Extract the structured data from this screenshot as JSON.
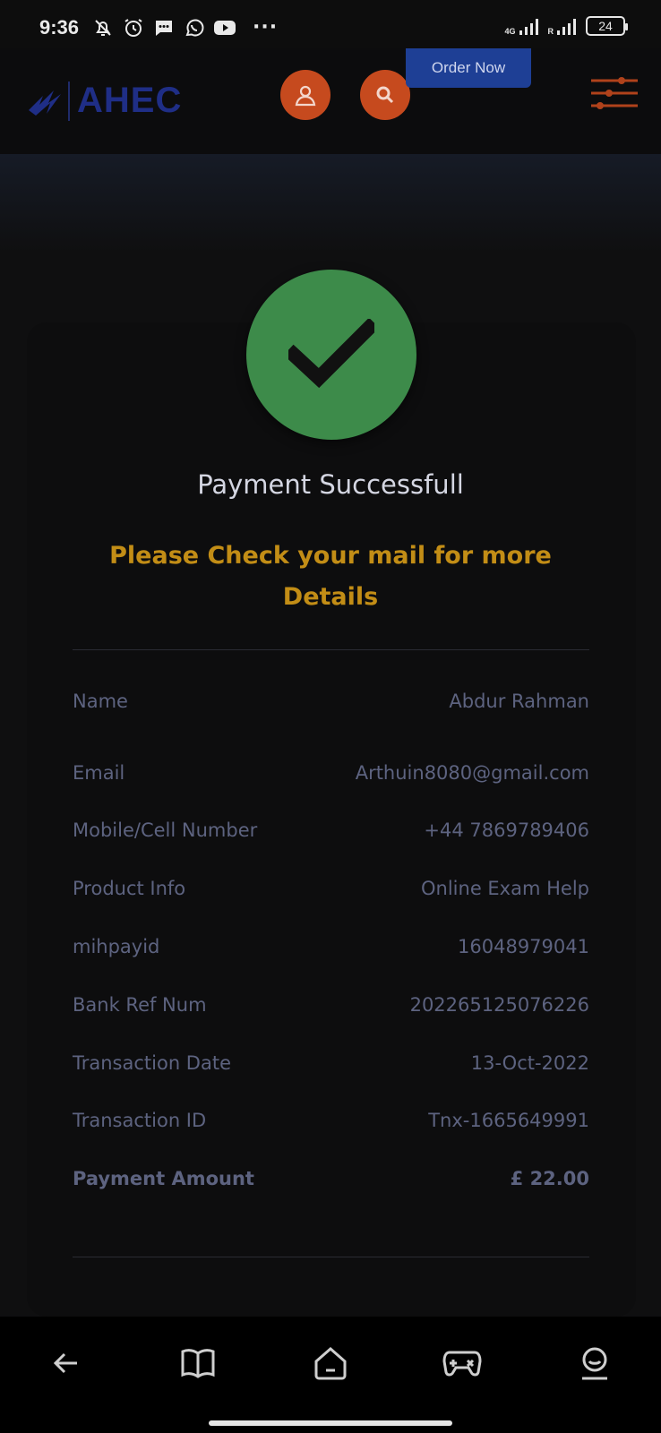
{
  "status_bar": {
    "time": "9:36",
    "icons": [
      "mute-bell-icon",
      "alarm-icon",
      "sms-icon",
      "whatsapp-icon",
      "youtube-icon"
    ],
    "more": "···",
    "signal1_label": "4G",
    "signal2_label": "R",
    "battery": "24"
  },
  "header": {
    "logo_text": "AHEC",
    "order_now": "Order Now",
    "accent": "#c64a1e",
    "brand_color": "#1f2e86"
  },
  "payment": {
    "title": "Payment Successfull",
    "note": "Please Check your mail for more Details",
    "status_color": "#3d8b4a",
    "rows": [
      {
        "label": "Name",
        "value": "Abdur Rahman"
      },
      {
        "label": "Email",
        "value": "Arthuin8080@gmail.com"
      },
      {
        "label": "Mobile/Cell Number",
        "value": "+44 7869789406"
      },
      {
        "label": "Product Info",
        "value": "Online Exam Help"
      },
      {
        "label": "mihpayid",
        "value": "16048979041"
      },
      {
        "label": "Bank Ref Num",
        "value": "202265125076226"
      },
      {
        "label": "Transaction Date",
        "value": "13-Oct-2022"
      },
      {
        "label": "Transaction ID",
        "value": "Tnx-1665649991"
      },
      {
        "label": "Payment Amount",
        "value": "£ 22.00"
      }
    ]
  },
  "bottom_nav": {
    "items": [
      "back-arrow-icon",
      "book-icon",
      "home-icon",
      "game-controller-icon",
      "profile-icon"
    ]
  }
}
